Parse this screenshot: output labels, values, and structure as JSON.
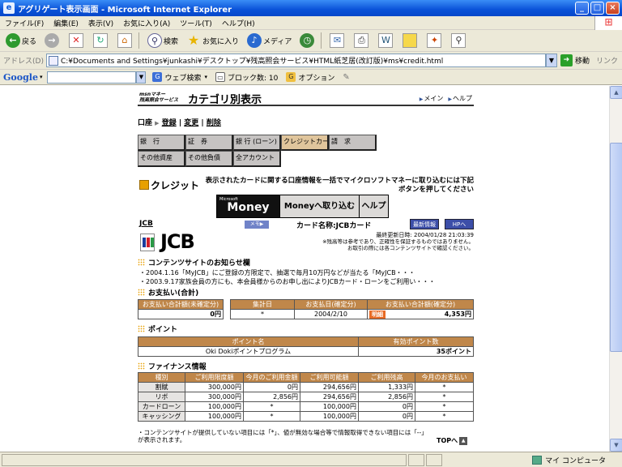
{
  "window": {
    "title": "アグリゲート表示画面 - Microsoft Internet Explorer",
    "minimize": "_",
    "maximize": "□",
    "close": "×"
  },
  "menu": [
    "ファイル(F)",
    "編集(E)",
    "表示(V)",
    "お気に入り(A)",
    "ツール(T)",
    "ヘルプ(H)"
  ],
  "toolbar": {
    "back": "戻る",
    "search": "検索",
    "favorites": "お気に入り",
    "media": "メディア"
  },
  "address": {
    "label": "アドレス(D)",
    "url": "C:¥Documents and Settings¥junkashi¥デスクトップ¥残高照会サービス¥HTML紙芝居(改訂版)¥ms¥credit.html",
    "go": "移動",
    "links": "リンク"
  },
  "google": {
    "logo": "Google",
    "web_search": "ウェブ検索",
    "blocked": "ブロック数: 10",
    "options": "オプション"
  },
  "page": {
    "brand_line1": "msnマネー",
    "brand_line2": "残高照会サービス",
    "title": "カテゴリ別表示",
    "link_main": "メイン",
    "link_help": "ヘルプ",
    "acct_label": "口座",
    "acct_register": "登録",
    "acct_change": "変更",
    "acct_delete": "削除",
    "tabs_row1": [
      "銀　行",
      "証　券",
      "銀 行 (ローン)",
      "クレジットカード",
      "請　求"
    ],
    "tabs_row2": [
      "その他資産",
      "その他負債",
      "全アカウント"
    ],
    "credit_title": "クレジット",
    "credit_desc": "表示されたカードに関する口座情報を一括でマイクロソフトマネーに取り込むには下記ボタンを押してください",
    "money_small": "Microsoft",
    "money_big": "Money",
    "import_btn": "Moneyへ取り込む",
    "help_btn": "ヘルプ",
    "card_short": "JCB",
    "memo": "メモ▶",
    "card_name": "カード名称:JCBカード",
    "latest_btn": "最新情報",
    "hp_btn": "HPへ",
    "jcb_logo": "JCB",
    "update_time": "最終更新日時: 2004/01/28 21:03:39",
    "update_note1": "※残高等は参考であり、正確性を保証するものではありません。",
    "update_note2": "お取引の際には各コンテンツサイトで確認ください。",
    "news_head": "コンテンツサイトのお知らせ欄",
    "news1": "・2004.1.16「MyJCB」にご登録の方限定で、抽選で毎月10万円などが当たる「MyJCB・・・",
    "news2": "・2003.9.17家族会員の方にも、本会員様からのお申し出によりJCBカード・ローンをご利用い・・・",
    "pay_head": "お支払い(合計)",
    "pay_unconfirmed_h": "お支払い合計額(未確定分)",
    "pay_unconfirmed_v": "0円",
    "pay_closing_h": "集計日",
    "pay_closing_v": "*",
    "pay_date_h": "お支払日(確定分)",
    "pay_date_v": "2004/2/10",
    "pay_total_h": "お支払い合計額(確定分)",
    "pay_total_badge": "明細",
    "pay_total_v": "4,353円",
    "point_head": "ポイント",
    "point_col1": "ポイント名",
    "point_col2": "有効ポイント数",
    "point_name": "Oki Dokiポイントプログラム",
    "point_value": "35ポイント",
    "fin_head": "ファイナンス情報",
    "fin_cols": [
      "種別",
      "ご利用限度額",
      "今月のご利用金額",
      "ご利用可能額",
      "ご利用残高",
      "今月のお支払い"
    ],
    "fin_rows": [
      [
        "割賦",
        "300,000円",
        "0円",
        "294,656円",
        "1,333円",
        "*"
      ],
      [
        "リボ",
        "300,000円",
        "2,856円",
        "294,656円",
        "2,856円",
        "*"
      ],
      [
        "カードローン",
        "100,000円",
        "*",
        "100,000円",
        "0円",
        "*"
      ],
      [
        "キャッシング",
        "100,000円",
        "*",
        "100,000円",
        "0円",
        "*"
      ]
    ],
    "footnote": "・コンテンツサイトが提供していない項目には「*」、値が無効な場合等で情報取得できない項目には「--」が表示されます。",
    "top_link": "TOPへ"
  },
  "status": {
    "zone": "マイ コンピュータ"
  }
}
